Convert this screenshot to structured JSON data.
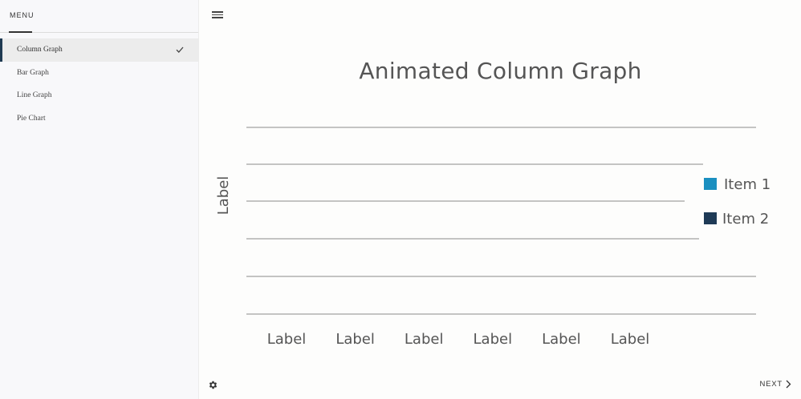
{
  "sidebar": {
    "menu_title": "MENU",
    "items": [
      {
        "label": "Column Graph",
        "active": true
      },
      {
        "label": "Bar Graph",
        "active": false
      },
      {
        "label": "Line Graph",
        "active": false
      },
      {
        "label": "Pie Chart",
        "active": false
      }
    ]
  },
  "icons": {
    "hamburger": "hamburger-icon",
    "check": "check-icon",
    "settings": "gear-icon",
    "next": "chevron-right-icon"
  },
  "footer": {
    "next_label": "NEXT"
  },
  "colors": {
    "accent": "#1f3a52",
    "item1": "#1a8fc0",
    "item2": "#1e3a56"
  },
  "chart_data": {
    "type": "bar",
    "title": "Animated Column Graph",
    "ylabel": "Label",
    "xlabel": "",
    "categories": [
      "Label",
      "Label",
      "Label",
      "Label",
      "Label",
      "Label"
    ],
    "series": [
      {
        "name": "Item 1",
        "color": "#1a8fc0"
      },
      {
        "name": "Item 2",
        "color": "#1e3a56"
      }
    ],
    "grid": true,
    "legend_position": "right"
  }
}
